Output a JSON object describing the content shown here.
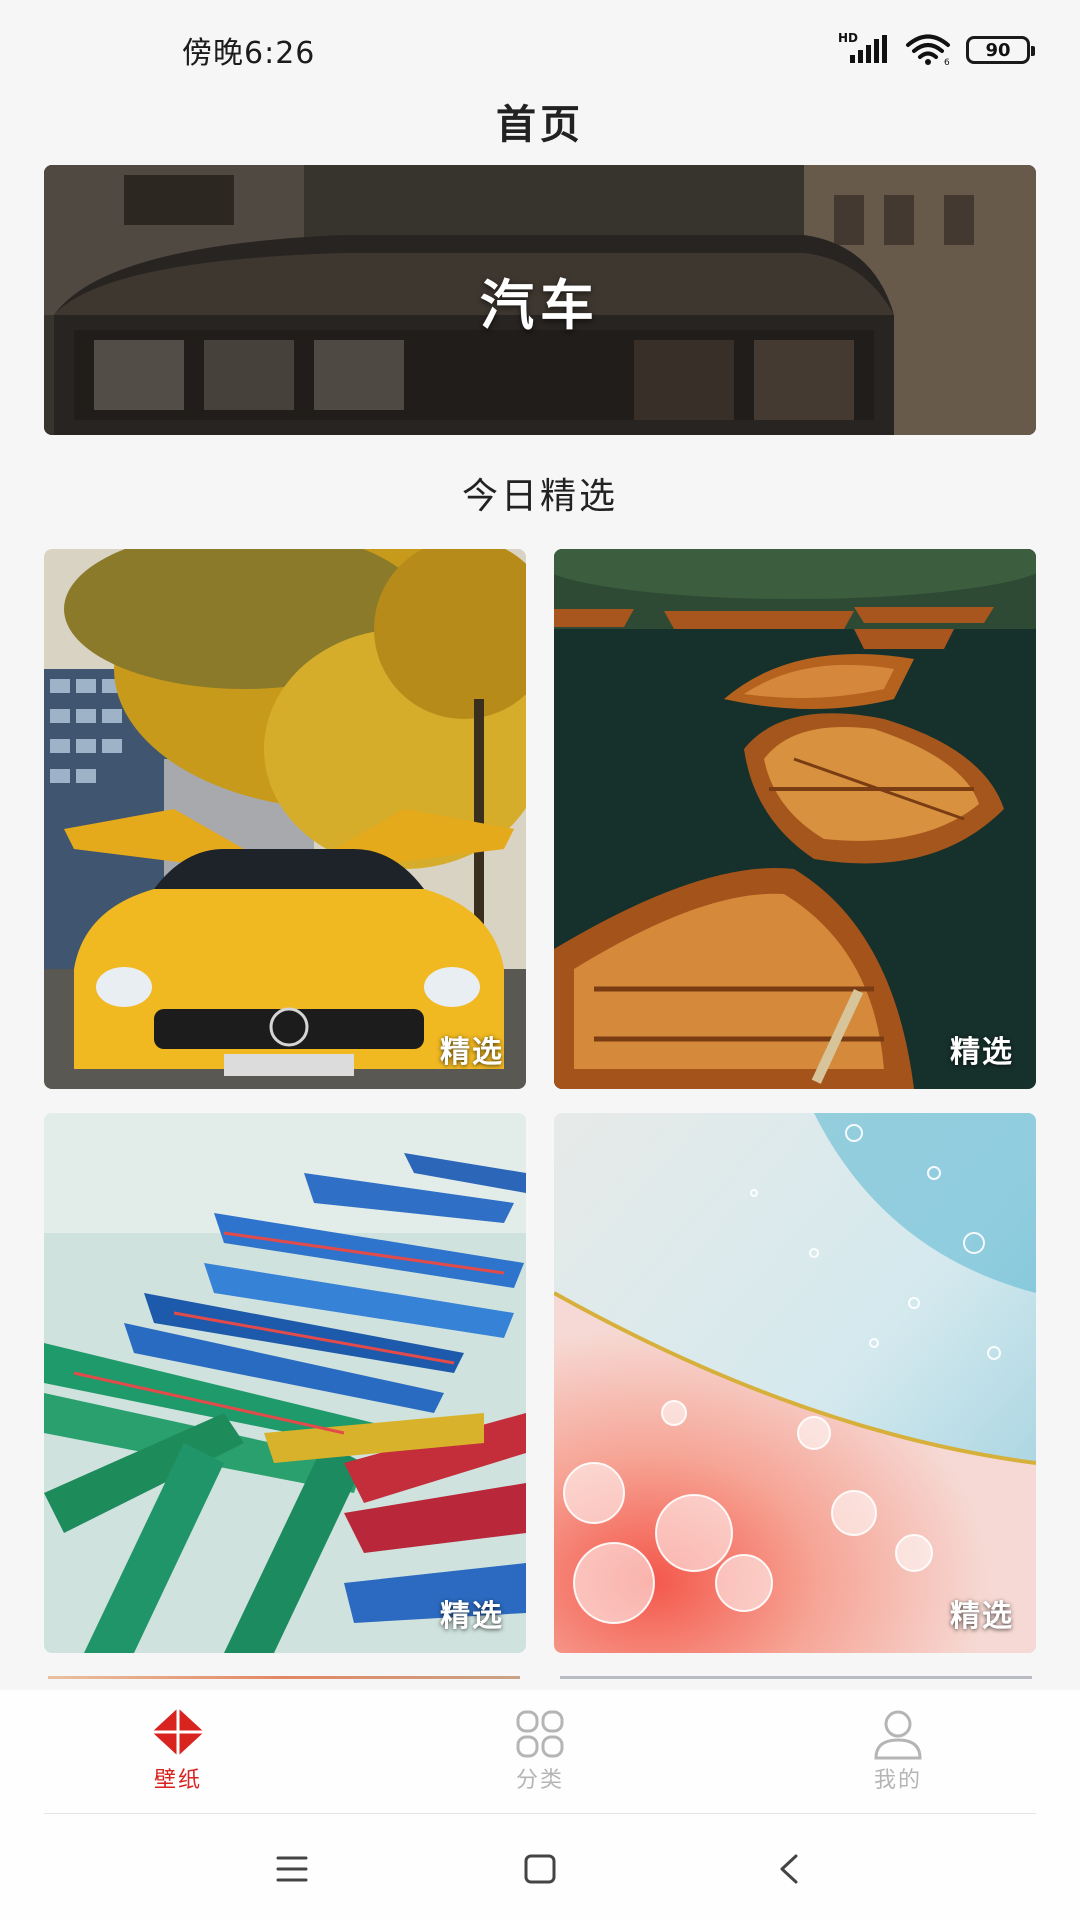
{
  "status_bar": {
    "time": "傍晚6:26",
    "network_label": "HD",
    "battery_level": "90",
    "icons": [
      "signal-icon",
      "wifi-icon",
      "battery-icon"
    ]
  },
  "header": {
    "title": "首页"
  },
  "banner": {
    "label": "汽车"
  },
  "section": {
    "title": "今日精选"
  },
  "grid": {
    "items": [
      {
        "tag": "精选"
      },
      {
        "tag": "精选"
      },
      {
        "tag": "精选"
      },
      {
        "tag": "精选"
      }
    ]
  },
  "bottom_nav": {
    "items": [
      {
        "label": "壁纸",
        "icon": "wallpaper-icon",
        "active": true
      },
      {
        "label": "分类",
        "icon": "category-icon",
        "active": false
      },
      {
        "label": "我的",
        "icon": "profile-icon",
        "active": false
      }
    ],
    "active_color": "#d8231e",
    "inactive_color": "#b5b5b5"
  },
  "system_nav": {
    "icons": [
      "menu-icon",
      "home-icon",
      "back-icon"
    ]
  }
}
